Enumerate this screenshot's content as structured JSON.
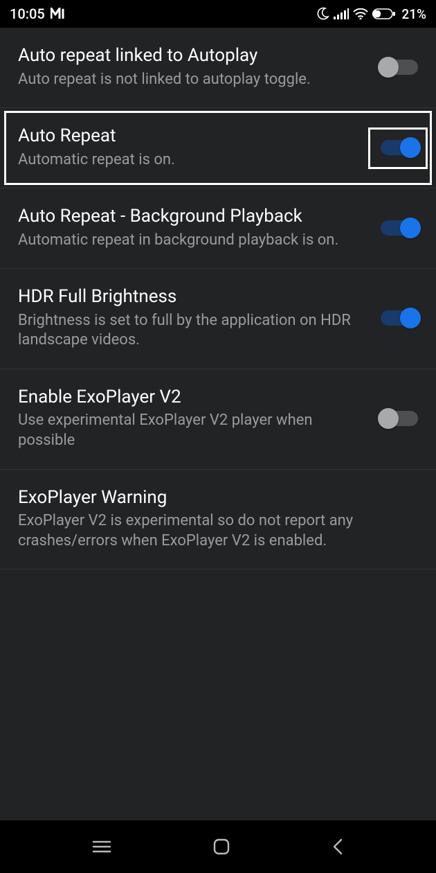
{
  "status": {
    "time": "10:05",
    "battery_pct": "21%"
  },
  "settings": [
    {
      "id": "autorepeat-linked",
      "title": "Auto repeat linked to Autoplay",
      "desc": "Auto repeat is not linked to autoplay toggle.",
      "has_toggle": true,
      "on": false,
      "highlight": false
    },
    {
      "id": "auto-repeat",
      "title": "Auto Repeat",
      "desc": "Automatic repeat is on.",
      "has_toggle": true,
      "on": true,
      "highlight": true
    },
    {
      "id": "auto-repeat-bg",
      "title": "Auto Repeat - Background Playback",
      "desc": "Automatic repeat in background playback is on.",
      "has_toggle": true,
      "on": true,
      "highlight": false
    },
    {
      "id": "hdr-brightness",
      "title": "HDR Full Brightness",
      "desc": "Brightness is set to full by the application on HDR landscape videos.",
      "has_toggle": true,
      "on": true,
      "highlight": false
    },
    {
      "id": "exoplayer-v2",
      "title": "Enable ExoPlayer V2",
      "desc": "Use experimental ExoPlayer V2 player when possible",
      "has_toggle": true,
      "on": false,
      "highlight": false
    },
    {
      "id": "exoplayer-warning",
      "title": "ExoPlayer Warning",
      "desc": "ExoPlayer V2 is experimental so do not report any crashes/errors when ExoPlayer V2 is enabled.",
      "has_toggle": false,
      "on": false,
      "highlight": false
    }
  ]
}
